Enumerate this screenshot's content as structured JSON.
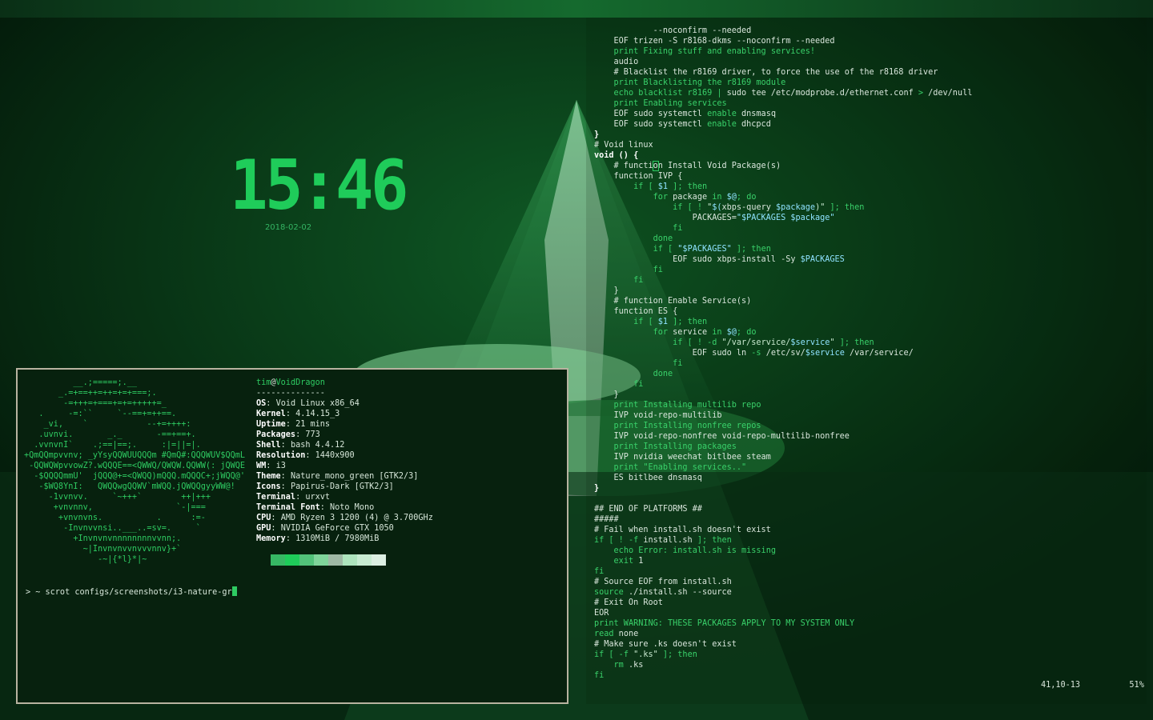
{
  "clock": {
    "time": "15:46",
    "date": "2018-02-02"
  },
  "terminal": {
    "ascii_art": [
      "          __.;=====;.__",
      "       _.=+==++=++=+=+===;.",
      "        -=+++=+===+=+=+++++=_",
      "   .     -=:``     `--==+=++==.",
      "    _vi,    `            --+=++++:",
      "   .uvnvi.       _._       -==+==+.",
      "  .vvnvnI`    .;==|==;.     :|=||=|.",
      "+QmQQmpvvnv; _yYsyQQWUUQQQm #QmQ#:QQQWUV$QQmL",
      " -QQWQWpvvowZ?.wQQQE==<QWWQ/QWQW.QQWW(: jQWQE",
      "  -$QQQQmmU'  jQQQ@+=<QWQQ)mQQQ.mQQQC+;jWQQ@'",
      "   -$WQ8YnI:   QWQQwgQQWV`mWQQ.jQWQQgyyWW@!",
      "     -1vvnvv.     `~+++`        ++|+++",
      "      +vnvnnv,                 `-|===",
      "       +vnvnvns.           .      :=-",
      "        -Invnvvnsi..___..=sv=.     `",
      "          +Invnvnvnnnnnnnnvvnn;.",
      "            ~|Invnvnvvnvvvnnv}+`",
      "               -~|{*l}*|~"
    ],
    "user": "tim",
    "at": "@",
    "host": "VoidDragon",
    "separator": "--------------",
    "info": [
      {
        "key": "OS",
        "value": "Void Linux x86_64"
      },
      {
        "key": "Kernel",
        "value": "4.14.15_3"
      },
      {
        "key": "Uptime",
        "value": "21 mins"
      },
      {
        "key": "Packages",
        "value": "773"
      },
      {
        "key": "Shell",
        "value": "bash 4.4.12"
      },
      {
        "key": "Resolution",
        "value": "1440x900"
      },
      {
        "key": "WM",
        "value": "i3"
      },
      {
        "key": "Theme",
        "value": "Nature_mono_green [GTK2/3]"
      },
      {
        "key": "Icons",
        "value": "Papirus-Dark [GTK2/3]"
      },
      {
        "key": "Terminal",
        "value": "urxvt"
      },
      {
        "key": "Terminal Font",
        "value": "Noto Mono"
      },
      {
        "key": "CPU",
        "value": "AMD Ryzen 3 1200 (4) @ 3.700GHz"
      },
      {
        "key": "GPU",
        "value": "NVIDIA GeForce GTX 1050"
      },
      {
        "key": "Memory",
        "value": "1310MiB / 7980MiB"
      }
    ],
    "palette": [
      "#37b864",
      "#1fcc5a",
      "#52c27a",
      "#7fd49a",
      "#9fb8a5",
      "#aee4bd",
      "#c8ecd2",
      "#dcefe2"
    ],
    "prompt": "> ~ scrot configs/screenshots/i3-nature-gr"
  },
  "editor": {
    "lines": [
      [
        [
          "            --noconfirm --needed",
          ""
        ]
      ],
      [
        [
          "    EOF trizen -S r8168-dkms --noconfirm --needed",
          ""
        ]
      ],
      [
        [
          "    ",
          ""
        ],
        [
          "print",
          "kw"
        ],
        [
          " Fixing stuff and enabling services!",
          "kw"
        ]
      ],
      [
        [
          "    audio",
          ""
        ]
      ],
      [
        [
          "    # Blacklist the r8169 driver, to force the use of the r8168 driver",
          ""
        ]
      ],
      [
        [
          "    ",
          ""
        ],
        [
          "print",
          "kw"
        ],
        [
          " Blacklisting the r8169 module",
          "kw"
        ]
      ],
      [
        [
          "    ",
          ""
        ],
        [
          "echo",
          "kw"
        ],
        [
          " blacklist r8169 ",
          "kw"
        ],
        [
          "|",
          "kw"
        ],
        [
          " sudo tee /etc/modprobe.d/ethernet.conf ",
          ""
        ],
        [
          ">",
          "kw"
        ],
        [
          " /dev/null",
          ""
        ]
      ],
      [
        [
          "    ",
          ""
        ],
        [
          "print",
          "kw"
        ],
        [
          " Enabling services",
          "kw"
        ]
      ],
      [
        [
          "    EOF sudo systemctl ",
          ""
        ],
        [
          "enable",
          "kw"
        ],
        [
          " dnsmasq",
          ""
        ]
      ],
      [
        [
          "    EOF sudo systemctl ",
          ""
        ],
        [
          "enable",
          "kw"
        ],
        [
          " dhcpcd",
          ""
        ]
      ],
      [
        [
          "}",
          "fn"
        ]
      ],
      [
        [
          "# Void linux",
          ""
        ]
      ],
      [
        [
          "void () {",
          "fn"
        ]
      ],
      [
        [
          "    # functi",
          ""
        ],
        [
          "o",
          "cur"
        ],
        [
          "n Install Void Package(s)",
          ""
        ]
      ],
      [
        [
          "    function IVP {",
          ""
        ]
      ],
      [
        [
          "        ",
          ""
        ],
        [
          "if",
          "kw"
        ],
        [
          " [ ",
          "kw"
        ],
        [
          "$1",
          "var"
        ],
        [
          " ]; then",
          "kw"
        ]
      ],
      [
        [
          "            ",
          ""
        ],
        [
          "for",
          "kw"
        ],
        [
          " package ",
          ""
        ],
        [
          "in",
          "kw"
        ],
        [
          " ",
          ""
        ],
        [
          "$@",
          "var"
        ],
        [
          "; do",
          "kw"
        ]
      ],
      [
        [
          "                ",
          ""
        ],
        [
          "if",
          "kw"
        ],
        [
          " [ ! ",
          "kw"
        ],
        [
          "\"",
          "str"
        ],
        [
          "$(",
          "var"
        ],
        [
          "xbps-query ",
          ""
        ],
        [
          "$package",
          "var"
        ],
        [
          ")\"",
          "str"
        ],
        [
          " ]; then",
          "kw"
        ]
      ],
      [
        [
          "                    PACKAGES=",
          ""
        ],
        [
          "\"$PACKAGES $package\"",
          "var"
        ]
      ],
      [
        [
          "                ",
          ""
        ],
        [
          "fi",
          "kw"
        ]
      ],
      [
        [
          "            ",
          ""
        ],
        [
          "done",
          "kw"
        ]
      ],
      [
        [
          "            ",
          ""
        ],
        [
          "if",
          "kw"
        ],
        [
          " [ ",
          "kw"
        ],
        [
          "\"$PACKAGES\"",
          "var"
        ],
        [
          " ]; then",
          "kw"
        ]
      ],
      [
        [
          "                EOF sudo xbps-install -Sy ",
          ""
        ],
        [
          "$PACKAGES",
          "var"
        ]
      ],
      [
        [
          "            ",
          ""
        ],
        [
          "fi",
          "kw"
        ]
      ],
      [
        [
          "        ",
          ""
        ],
        [
          "fi",
          "kw"
        ]
      ],
      [
        [
          "    }",
          ""
        ]
      ],
      [
        [
          "    # function Enable Service(s)",
          ""
        ]
      ],
      [
        [
          "    function ES {",
          ""
        ]
      ],
      [
        [
          "        ",
          ""
        ],
        [
          "if",
          "kw"
        ],
        [
          " [ ",
          "kw"
        ],
        [
          "$1",
          "var"
        ],
        [
          " ]; then",
          "kw"
        ]
      ],
      [
        [
          "            ",
          ""
        ],
        [
          "for",
          "kw"
        ],
        [
          " service ",
          ""
        ],
        [
          "in",
          "kw"
        ],
        [
          " ",
          ""
        ],
        [
          "$@",
          "var"
        ],
        [
          "; do",
          "kw"
        ]
      ],
      [
        [
          "                ",
          ""
        ],
        [
          "if",
          "kw"
        ],
        [
          " [ ! -d ",
          "kw"
        ],
        [
          "\"/var/service/",
          "str"
        ],
        [
          "$service",
          "var"
        ],
        [
          "\"",
          "str"
        ],
        [
          " ]; then",
          "kw"
        ]
      ],
      [
        [
          "                    EOF sudo ln ",
          ""
        ],
        [
          "-s",
          "kw"
        ],
        [
          " /etc/sv/",
          ""
        ],
        [
          "$service",
          "var"
        ],
        [
          " /var/service/",
          ""
        ]
      ],
      [
        [
          "                ",
          ""
        ],
        [
          "fi",
          "kw"
        ]
      ],
      [
        [
          "            ",
          ""
        ],
        [
          "done",
          "kw"
        ]
      ],
      [
        [
          "        ",
          ""
        ],
        [
          "fi",
          "kw"
        ]
      ],
      [
        [
          "    }",
          ""
        ]
      ],
      [
        [
          "    ",
          ""
        ],
        [
          "print",
          "kw"
        ],
        [
          " Installing multilib repo",
          "kw"
        ]
      ],
      [
        [
          "    IVP void-repo-multilib",
          ""
        ]
      ],
      [
        [
          "    ",
          ""
        ],
        [
          "print",
          "kw"
        ],
        [
          " Installing nonfree repos",
          "kw"
        ]
      ],
      [
        [
          "    IVP void-repo-nonfree void-repo-multilib-nonfree",
          ""
        ]
      ],
      [
        [
          "    ",
          ""
        ],
        [
          "print",
          "kw"
        ],
        [
          " Installing packages",
          "kw"
        ]
      ],
      [
        [
          "    IVP nvidia weechat bitlbee steam",
          ""
        ]
      ],
      [
        [
          "    ",
          ""
        ],
        [
          "print",
          "kw"
        ],
        [
          " \"Enabling services..\"",
          "kw"
        ]
      ],
      [
        [
          "    ES bitlbee dnsmasq",
          ""
        ]
      ],
      [
        [
          "}",
          "fn"
        ]
      ],
      [
        [
          "",
          ""
        ]
      ],
      [
        [
          "## END OF PLATFORMS ##",
          ""
        ]
      ],
      [
        [
          "#####",
          ""
        ]
      ],
      [
        [
          "# Fail when install.sh doesn't exist",
          ""
        ]
      ],
      [
        [
          "if",
          "kw"
        ],
        [
          " [ ! -f ",
          "kw"
        ],
        [
          "install.sh",
          ""
        ],
        [
          " ]; then",
          "kw"
        ]
      ],
      [
        [
          "    ",
          ""
        ],
        [
          "echo",
          "kw"
        ],
        [
          " Error: install.sh is missing",
          "kw"
        ]
      ],
      [
        [
          "    ",
          ""
        ],
        [
          "exit",
          "kw"
        ],
        [
          " 1",
          ""
        ]
      ],
      [
        [
          "fi",
          "kw"
        ]
      ],
      [
        [
          "# Source EOF from install.sh",
          ""
        ]
      ],
      [
        [
          "source",
          "kw"
        ],
        [
          " ./install.sh --source",
          ""
        ]
      ],
      [
        [
          "# Exit On Root",
          ""
        ]
      ],
      [
        [
          "EOR",
          ""
        ]
      ],
      [
        [
          "print",
          "kw"
        ],
        [
          " WARNING: THESE PACKAGES APPLY TO MY SYSTEM ONLY",
          "kw"
        ]
      ],
      [
        [
          "read",
          "kw"
        ],
        [
          " none",
          ""
        ]
      ],
      [
        [
          "# Make sure .ks doesn't exist",
          ""
        ]
      ],
      [
        [
          "if",
          "kw"
        ],
        [
          " [ -f ",
          "kw"
        ],
        [
          "\".ks\"",
          "str"
        ],
        [
          " ]; then",
          "kw"
        ]
      ],
      [
        [
          "    ",
          ""
        ],
        [
          "rm",
          "kw"
        ],
        [
          " .ks",
          ""
        ]
      ],
      [
        [
          "fi",
          "kw"
        ]
      ]
    ],
    "status": {
      "position": "41,10-13",
      "percent": "51%"
    }
  }
}
